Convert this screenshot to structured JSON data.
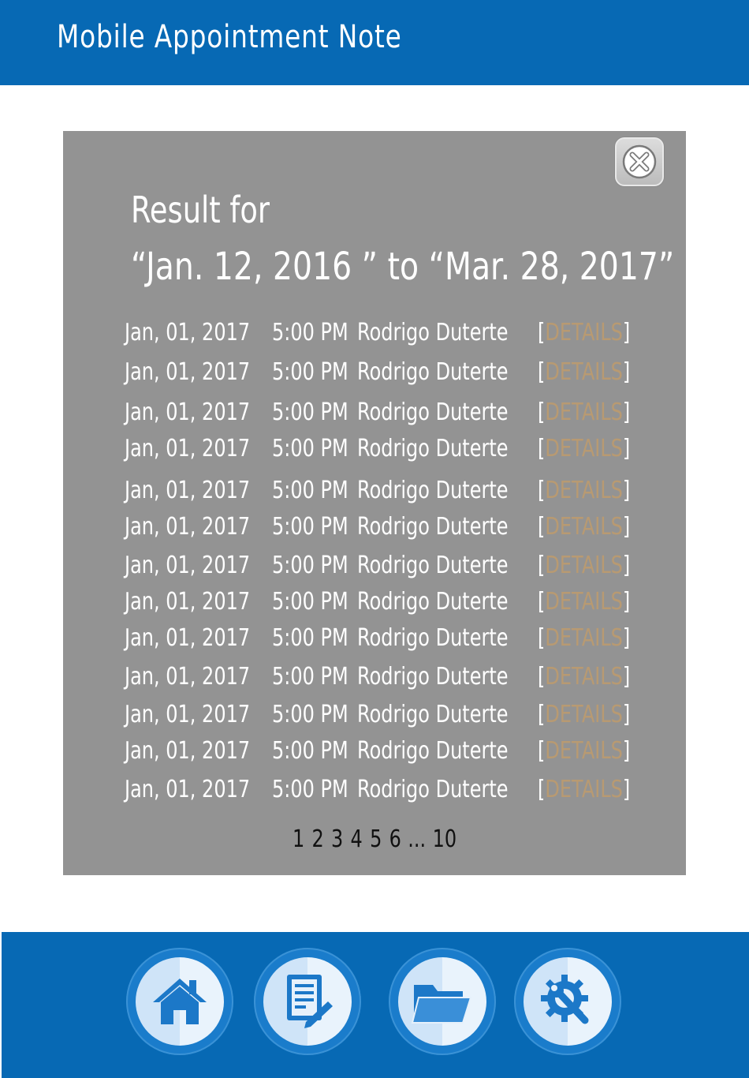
{
  "app": {
    "title": "Mobile Appointment Note"
  },
  "result": {
    "heading": "Result for",
    "range": "“Jan. 12, 2016 ” to “Mar. 28, 2017”"
  },
  "appointments": [
    {
      "date": "Jan, 01, 2017",
      "time": "5:00 PM",
      "name": "Rodrigo Duterte",
      "details": "DETAILS"
    },
    {
      "date": "Jan, 01, 2017",
      "time": "5:00 PM",
      "name": "Rodrigo Duterte",
      "details": "DETAILS"
    },
    {
      "date": "Jan, 01, 2017",
      "time": "5:00 PM",
      "name": "Rodrigo Duterte",
      "details": "DETAILS"
    },
    {
      "date": "Jan, 01, 2017",
      "time": "5:00 PM",
      "name": "Rodrigo Duterte",
      "details": "DETAILS"
    },
    {
      "date": "Jan, 01, 2017",
      "time": "5:00 PM",
      "name": "Rodrigo Duterte",
      "details": "DETAILS"
    },
    {
      "date": "Jan, 01, 2017",
      "time": "5:00 PM",
      "name": "Rodrigo Duterte",
      "details": "DETAILS"
    },
    {
      "date": "Jan, 01, 2017",
      "time": "5:00 PM",
      "name": "Rodrigo Duterte",
      "details": "DETAILS"
    },
    {
      "date": "Jan, 01, 2017",
      "time": "5:00 PM",
      "name": "Rodrigo Duterte",
      "details": "DETAILS"
    },
    {
      "date": "Jan, 01, 2017",
      "time": "5:00 PM",
      "name": "Rodrigo Duterte",
      "details": "DETAILS"
    },
    {
      "date": "Jan, 01, 2017",
      "time": "5:00 PM",
      "name": "Rodrigo Duterte",
      "details": "DETAILS"
    },
    {
      "date": "Jan, 01, 2017",
      "time": "5:00 PM",
      "name": "Rodrigo Duterte",
      "details": "DETAILS"
    },
    {
      "date": "Jan, 01, 2017",
      "time": "5:00 PM",
      "name": "Rodrigo Duterte",
      "details": "DETAILS"
    },
    {
      "date": "Jan, 01, 2017",
      "time": "5:00 PM",
      "name": "Rodrigo Duterte",
      "details": "DETAILS"
    }
  ],
  "pagination": {
    "pages": [
      "1",
      "2",
      "3",
      "4",
      "5",
      "6"
    ],
    "ellipsis": "...",
    "last": "10"
  },
  "footer_nav": [
    {
      "icon": "home-icon"
    },
    {
      "icon": "document-edit-icon"
    },
    {
      "icon": "folder-icon"
    },
    {
      "icon": "settings-tools-icon"
    }
  ],
  "colors": {
    "brand_blue": "#0769b4",
    "panel_gray": "#939393",
    "details_link": "#b89a72"
  }
}
